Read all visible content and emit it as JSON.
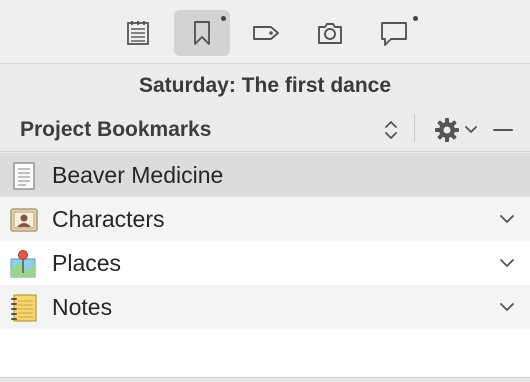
{
  "toolbar": {
    "buttons": [
      {
        "icon": "calendar-icon",
        "active": false,
        "badge": false
      },
      {
        "icon": "bookmark-icon",
        "active": true,
        "badge": true
      },
      {
        "icon": "tag-icon",
        "active": false,
        "badge": false
      },
      {
        "icon": "camera-icon",
        "active": false,
        "badge": false
      },
      {
        "icon": "comment-icon",
        "active": false,
        "badge": true
      }
    ]
  },
  "document": {
    "title": "Saturday: The first dance"
  },
  "bookmarks": {
    "header_label": "Project Bookmarks",
    "controls": [
      "sort-stepper-icon",
      "gear-icon",
      "chevron-down-icon",
      "minus-icon"
    ],
    "items": [
      {
        "label": "Beaver Medicine",
        "icon": "document-icon",
        "expandable": false,
        "selected": true
      },
      {
        "label": "Characters",
        "icon": "character-card-icon",
        "expandable": true,
        "selected": false
      },
      {
        "label": "Places",
        "icon": "map-pin-icon",
        "expandable": true,
        "selected": false
      },
      {
        "label": "Notes",
        "icon": "notepad-icon",
        "expandable": true,
        "selected": false
      }
    ]
  },
  "colors": {
    "background": "#ececec",
    "selected_row": "#dcdcdc",
    "active_tool": "#d3d3d3",
    "icon_stroke": "#555555"
  }
}
